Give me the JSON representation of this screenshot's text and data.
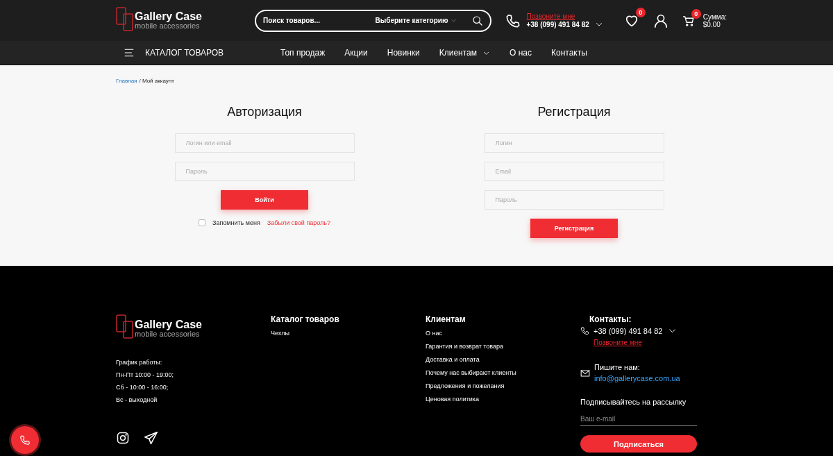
{
  "header": {
    "logo": {
      "title": "Gallery Case",
      "subtitle": "mobile accessories"
    },
    "search": {
      "placeholder": "Поиск товаров...",
      "category": "Выберите категорию"
    },
    "phone": {
      "callback": "Позвоните мне",
      "number": "+38 (099) 491 84 82"
    },
    "wishlist_count": "0",
    "cart_count": "0",
    "cart_total": {
      "label": "Сумма:",
      "value": "$0.00"
    }
  },
  "nav": {
    "catalog": "КАТАЛОГ ТОВАРОВ",
    "links": [
      {
        "label": "Топ продаж",
        "has_dropdown": false
      },
      {
        "label": "Акции",
        "has_dropdown": false
      },
      {
        "label": "Новинки",
        "has_dropdown": false
      },
      {
        "label": "Клиентам",
        "has_dropdown": true
      },
      {
        "label": "О нас",
        "has_dropdown": false
      },
      {
        "label": "Контакты",
        "has_dropdown": false
      }
    ]
  },
  "breadcrumb": {
    "home": "Главная",
    "current": "/ Мой аккаунт"
  },
  "login": {
    "title": "Авторизация",
    "fields": [
      {
        "placeholder": "Логин или email"
      },
      {
        "placeholder": "Пароль"
      }
    ],
    "button": "Войти",
    "remember": {
      "label": "Запомнить меня",
      "checked": false
    },
    "forgot": "Забыли свой пароль?"
  },
  "register": {
    "title": "Регистрация",
    "fields": [
      {
        "placeholder": "Логин"
      },
      {
        "placeholder": "Email"
      },
      {
        "placeholder": "Пароль"
      }
    ],
    "button": "Регистрация"
  },
  "footer": {
    "logo": {
      "title": "Gallery Case",
      "subtitle": "mobile accessories"
    },
    "schedule": [
      "График работы:",
      "Пн-Пт 10:00 - 19:00;",
      "Сб - 10:00 - 16:00;",
      "Вс - выходной"
    ],
    "catalog": {
      "title": "Каталог товаров",
      "links": [
        "Чехлы"
      ]
    },
    "clients": {
      "title": "Клиентам",
      "links": [
        "О нас",
        "Гарантия и возврат товара",
        "Доставка и оплата",
        "Почему нас выбирают клиенты",
        "Предложения и пожелания",
        "Ценовая политика"
      ]
    },
    "contacts": {
      "title": "Контакты:",
      "phone": "+38 (099) 491 84 82",
      "callback": "Позвоните мне",
      "write_label": "Пишите нам:",
      "email": "info@gallerycase.com.ua",
      "subscribe_label": "Подписывайтесь на рассылку",
      "email_placeholder": "Ваш e-mail",
      "button": "Подписаться"
    }
  }
}
